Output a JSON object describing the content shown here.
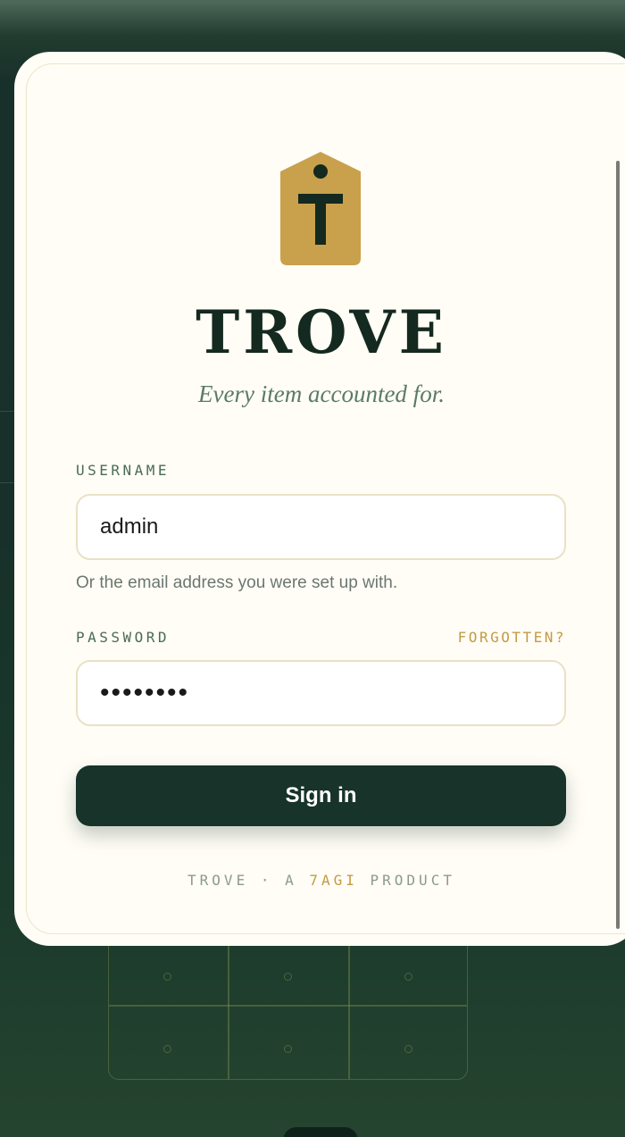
{
  "brand": {
    "title": "TROVE",
    "tagline": "Every item accounted for."
  },
  "login": {
    "username_label": "USERNAME",
    "username_value": "admin",
    "username_hint": "Or the email address you were set up with.",
    "password_label": "PASSWORD",
    "forgot_label": "FORGOTTEN?",
    "password_value": "••••••••",
    "signin_label": "Sign in"
  },
  "footer": {
    "prefix": "TROVE · A ",
    "company": "7AGI",
    "suffix": " PRODUCT"
  },
  "icons": {
    "logo": "tag-icon"
  },
  "colors": {
    "primary": "#17332a",
    "accent": "#c49a45",
    "card_background": "#fffdf6",
    "page_background": "#18302a"
  }
}
